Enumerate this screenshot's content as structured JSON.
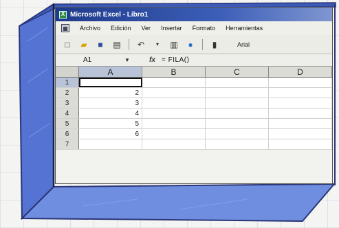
{
  "window": {
    "title": "Microsoft Excel - Libro1",
    "app_icon": "excel-icon"
  },
  "menubar": {
    "items": [
      "Archivo",
      "Edición",
      "Ver",
      "Insertar",
      "Formato",
      "Herramientas"
    ]
  },
  "toolbar": {
    "icons": [
      "new-document-icon",
      "open-folder-icon",
      "save-icon",
      "print-icon",
      "undo-icon",
      "dropdown-icon",
      "chart-icon",
      "globe-icon",
      "scroll-icon"
    ],
    "font_name": "Arial"
  },
  "formula_bar": {
    "name_box": "A1",
    "fx_label": "fx",
    "formula": "= FILA()"
  },
  "grid": {
    "columns": [
      "A",
      "B",
      "C",
      "D"
    ],
    "rows": [
      {
        "num": "1",
        "cells": [
          "",
          "",
          "",
          ""
        ]
      },
      {
        "num": "2",
        "cells": [
          "2",
          "",
          "",
          ""
        ]
      },
      {
        "num": "3",
        "cells": [
          "3",
          "",
          "",
          ""
        ]
      },
      {
        "num": "4",
        "cells": [
          "4",
          "",
          "",
          ""
        ]
      },
      {
        "num": "5",
        "cells": [
          "5",
          "",
          "",
          ""
        ]
      },
      {
        "num": "6",
        "cells": [
          "6",
          "",
          "",
          ""
        ]
      },
      {
        "num": "7",
        "cells": [
          "",
          "",
          "",
          ""
        ]
      }
    ],
    "active_cell": "A1"
  },
  "colors": {
    "frame_blue": "#5b7ad6",
    "frame_dark": "#2f3f8f",
    "titlebar": "#1e3a8a"
  }
}
